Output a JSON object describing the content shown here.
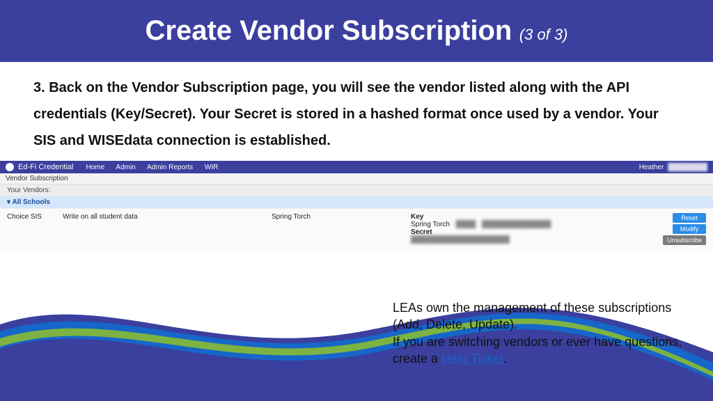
{
  "header": {
    "title": "Create Vendor Subscription",
    "step": "(3 of 3)"
  },
  "step_text": "3. Back on the Vendor Subscription page, you will see the vendor listed along with the API credentials (Key/Secret). Your Secret is stored in a hashed format once used by a vendor. Your SIS and WISEdata connection is established.",
  "app": {
    "name": "Ed-Fi Credential",
    "nav": {
      "home": "Home",
      "admin": "Admin",
      "reports": "Admin Reports",
      "wir": "WIR"
    },
    "user": "Heather",
    "tab": "Vendor Subscription",
    "section": "Your Vendors:",
    "expand": "All Schools",
    "row": {
      "choice": "Choice SIS",
      "scope": "Write on all student data",
      "vendor": "Spring Torch",
      "key_label": "Key",
      "key_value": "Spring Torch",
      "secret_label": "Secret"
    },
    "buttons": {
      "reset": "Reset",
      "modify": "Modify",
      "unsub": "Unsubscribe"
    }
  },
  "footer": {
    "line1": "LEAs own the management of these subscriptions (Add, Delete, Update).",
    "line2a": "If you are switching vendors or ever have questions, create a ",
    "link": "Help Ticket",
    "line2b": "."
  }
}
